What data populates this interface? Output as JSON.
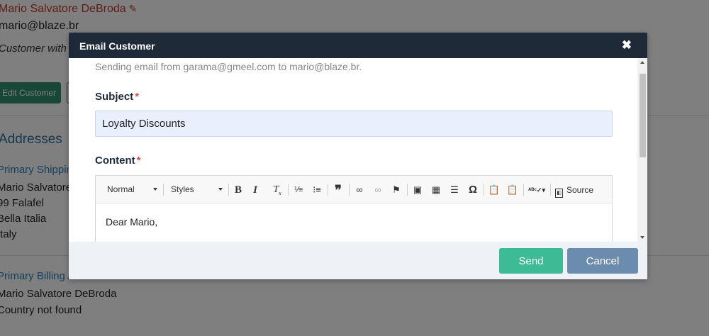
{
  "background": {
    "customer_name": "Mario Salvatore DeBroda",
    "customer_email": "mario@blaze.br",
    "customer_note": "Customer with d",
    "edit_button_label": "Edit Customer",
    "addresses_heading": "Addresses",
    "shipping_title": "Primary Shippin",
    "shipping_lines": [
      "Mario Salvatore",
      "99 Falafel",
      "Bella Italia",
      "Italy"
    ],
    "billing_title": "Primary Billing A",
    "billing_lines": [
      "Mario Salvatore DeBroda",
      "Country not found"
    ]
  },
  "modal": {
    "title": "Email Customer",
    "close_icon": "close-icon",
    "sending_note": "Sending email from garama@gmeel.com to mario@blaze.br.",
    "subject_label": "Subject",
    "required_mark": "*",
    "subject_value": "Loyalty Discounts",
    "content_label": "Content",
    "editor": {
      "format_value": "Normal",
      "styles_value": "Styles",
      "toolbar_icons": [
        "bold-icon",
        "italic-icon",
        "remove-format-icon",
        "numbered-list-icon",
        "bulleted-list-icon",
        "blockquote-icon",
        "link-icon",
        "unlink-icon",
        "anchor-icon",
        "image-icon",
        "table-icon",
        "horizontal-line-icon",
        "special-char-icon",
        "paste-text-icon",
        "paste-word-icon",
        "spellcheck-icon",
        "source-icon"
      ],
      "source_label": "Source",
      "body_text": "Dear Mario,"
    },
    "send_label": "Send",
    "cancel_label": "Cancel"
  },
  "colors": {
    "header_bg": "#1e2a38",
    "send_btn": "#3dbb95",
    "cancel_btn": "#6c8cad",
    "required": "#d9534f"
  }
}
